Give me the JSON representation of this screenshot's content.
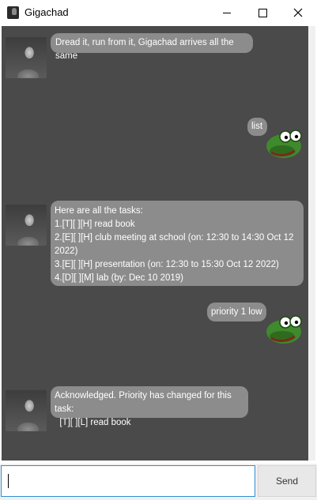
{
  "window": {
    "title": "Gigachad"
  },
  "messages": [
    {
      "sender": "duke",
      "text": "Dread it, run from it, Gigachad arrives all the same"
    },
    {
      "sender": "user",
      "text": "list"
    },
    {
      "sender": "duke",
      "text": "Here are all the tasks:\n1.[T][ ][H] read book\n2.[E][ ][H] club meeting at school (on: 12:30 to 14:30 Oct 12\n2022)\n3.[E][ ][H] presentation (on: 12:30 to 15:30 Oct 12 2022)\n4.[D][ ][M] lab (by: Dec 10 2019)"
    },
    {
      "sender": "user",
      "text": "priority 1 low"
    },
    {
      "sender": "duke",
      "text": "Acknowledged. Priority has changed for this task:\n  [T][ ][L] read book"
    }
  ],
  "input": {
    "value": "",
    "placeholder": ""
  },
  "send_button": {
    "label": "Send"
  },
  "icons": {
    "duke_avatar": "gigachad-avatar",
    "user_avatar": "pepe-frog-avatar"
  },
  "colors": {
    "chat_background": "#4a4a4a",
    "bubble": "#8c8c8c",
    "input_focus": "#2e8fd6"
  }
}
